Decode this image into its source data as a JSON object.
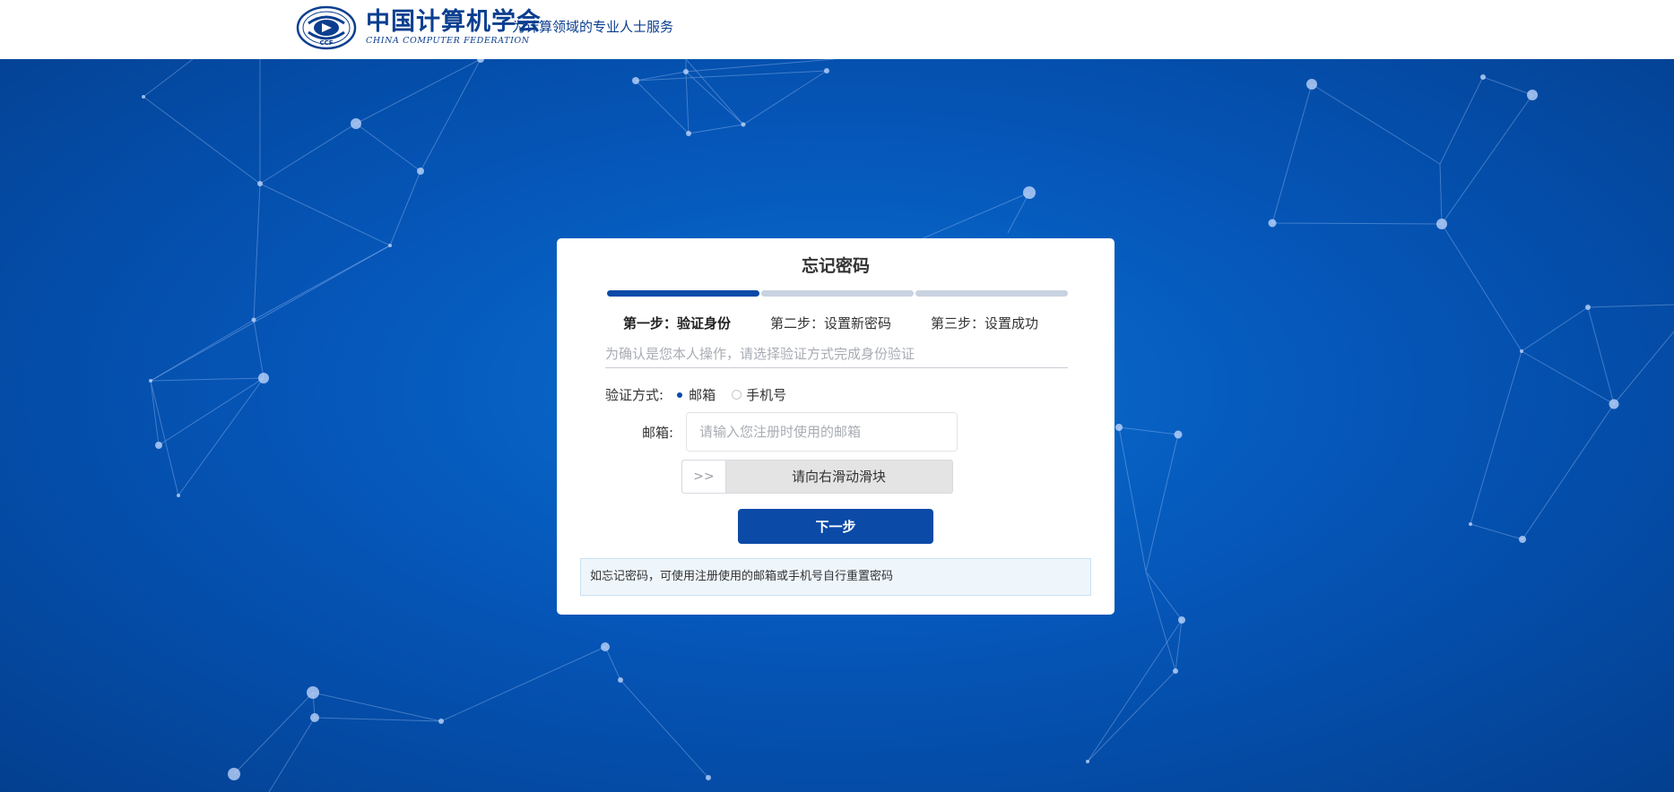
{
  "header": {
    "logo_name_cn": "中国计算机学会",
    "logo_name_en": "CHINA COMPUTER FEDERATION",
    "logo_seal_text": "CCF",
    "slogan": "为计算领域的专业人士服务"
  },
  "card": {
    "title": "忘记密码",
    "progress": {
      "current_step": 1,
      "total_steps": 3
    },
    "steps": [
      "第一步：验证身份",
      "第二步：设置新密码",
      "第三步：设置成功"
    ],
    "instruction": "为确认是您本人操作，请选择验证方式完成身份验证",
    "method": {
      "label": "验证方式:",
      "options": [
        "邮箱",
        "手机号"
      ],
      "selected": "邮箱"
    },
    "email": {
      "label": "邮箱:",
      "placeholder": "请输入您注册时使用的邮箱",
      "value": ""
    },
    "slider": {
      "handle_icon": "double-chevron-right-icon",
      "handle_glyph": ">>",
      "text": "请向右滑动滑块"
    },
    "next_button": "下一步",
    "tip": "如忘记密码，可使用注册使用的邮箱或手机号自行重置密码"
  },
  "colors": {
    "brand": "#0b4aa7",
    "background": "#0556b8",
    "tip_background": "#eef6fc"
  }
}
